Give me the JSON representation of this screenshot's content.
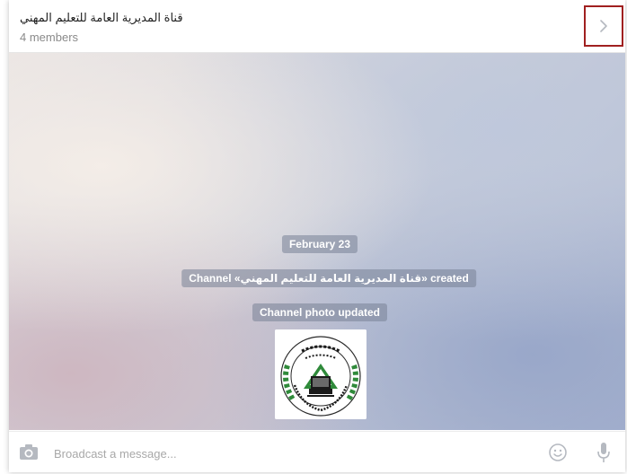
{
  "header": {
    "title": "قناة المديرية العامة للتعليم المهني",
    "members": "4 members"
  },
  "chat": {
    "date": "February 23",
    "created": "Channel «قناة المديرية العامة للتعليم المهني» created",
    "photo_updated": "Channel photo updated",
    "photo": {
      "logo_text_top": "وزارة التربية",
      "logo_text_mid": "المديرية العامة للتعليم المهني",
      "logo_ring_text": "Ministry Of Education · General Directorate Vocational Education"
    }
  },
  "composer": {
    "placeholder": "Broadcast a message..."
  },
  "icons": {
    "info": "chevron-right-icon",
    "attach": "camera-icon",
    "emoji": "smiley-icon",
    "voice": "microphone-icon"
  },
  "colors": {
    "highlight_border": "#a02020",
    "service_bg": "#78829699",
    "icon_gray": "#b5b9c0"
  }
}
